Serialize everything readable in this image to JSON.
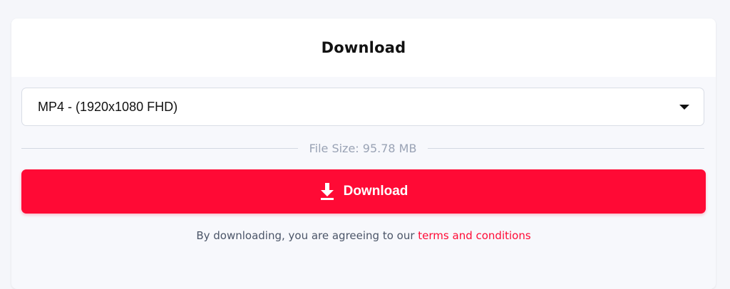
{
  "header": {
    "title": "Download"
  },
  "format_select": {
    "selected": "MP4 - (1920x1080 FHD)"
  },
  "file_info": {
    "size_label": "File Size: 95.78 MB"
  },
  "download_button": {
    "label": "Download",
    "icon": "download-icon"
  },
  "terms": {
    "prefix": "By downloading, you are agreeing to our ",
    "link_text": "terms and conditions"
  },
  "colors": {
    "accent": "#ff0a35",
    "background": "#f5f6fa",
    "muted_text": "#9aa3b5"
  }
}
